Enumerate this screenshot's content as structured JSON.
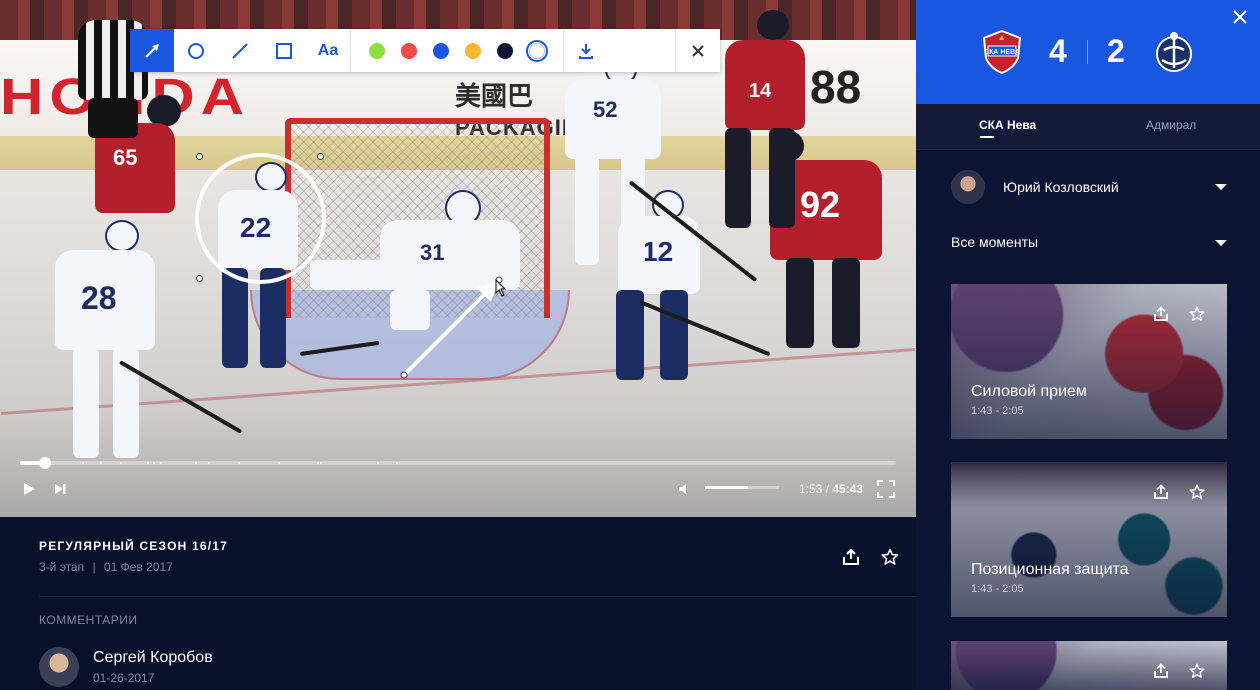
{
  "draw_toolbar": {
    "tools": [
      "arrow",
      "circle",
      "line",
      "rectangle",
      "text"
    ],
    "text_tool_label": "Aa",
    "active_tool": "arrow",
    "colors": [
      "#8fe03a",
      "#f04a4a",
      "#1a57e0",
      "#f7b731",
      "#0c1433",
      "#ffffff"
    ],
    "selected_color": "#ffffff"
  },
  "video": {
    "current_time": "1:53",
    "time_separator": " / ",
    "duration": "45:43",
    "progress_fraction": 0.029,
    "volume_fraction": 0.58
  },
  "match_info": {
    "season_title": "РЕГУЛЯРНЫЙ СЕЗОН 16/17",
    "stage": "3-й этап",
    "separator": "|",
    "date": "01 Фев 2017"
  },
  "comments": {
    "label": "КОММЕНТАРИИ",
    "items": [
      {
        "author": "Сергей Коробов",
        "date": "01-26-2017"
      }
    ]
  },
  "scoreboard": {
    "home_score": "4",
    "away_score": "2",
    "home_logo_text": "СКА НЕВА",
    "colors": {
      "header": "#1a57e0",
      "panel": "#0c1433",
      "accent": "#1a57e0"
    }
  },
  "team_tabs": [
    {
      "label": "СКА Нева",
      "active": true
    },
    {
      "label": "Адмирал",
      "active": false
    }
  ],
  "player_select": {
    "name": "Юрий Козловский"
  },
  "moments_select": {
    "label": "Все моменты"
  },
  "moments": [
    {
      "title": "Силовой прием",
      "time": "1:43 - 2:05"
    },
    {
      "title": "Позиционная защита",
      "time": "1:43 - 2:05"
    },
    {
      "title": "",
      "time": ""
    }
  ],
  "video_text": {
    "ad_left": "HONDA",
    "ad_mid_cn": "美國巴",
    "ad_mid": "PACKAGING",
    "ad_right": "88",
    "players": [
      "22",
      "31",
      "12",
      "28",
      "65",
      "92",
      "52",
      "14"
    ]
  }
}
